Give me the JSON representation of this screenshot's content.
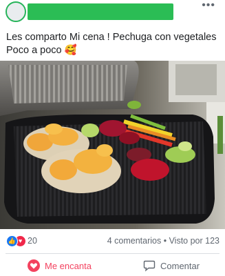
{
  "post": {
    "author_redacted": true,
    "more_icon": "more-horizontal-icon",
    "text_line1": "Les comparto Mi cena ! Pechuga con vegetales",
    "text_line2": "Poco a poco",
    "emoji": "🥰"
  },
  "photo": {
    "description_icon": "food-photo"
  },
  "stats": {
    "reaction_icons": [
      "like-icon",
      "love-icon"
    ],
    "reaction_count": "20",
    "comments_views": "4 comentarios • Visto por 123"
  },
  "actions": {
    "love_label": "Me encanta",
    "comment_label": "Comentar"
  },
  "colors": {
    "love_active": "#f3425f",
    "like_blue": "#1877f2",
    "redaction_green": "#2bbd55"
  }
}
